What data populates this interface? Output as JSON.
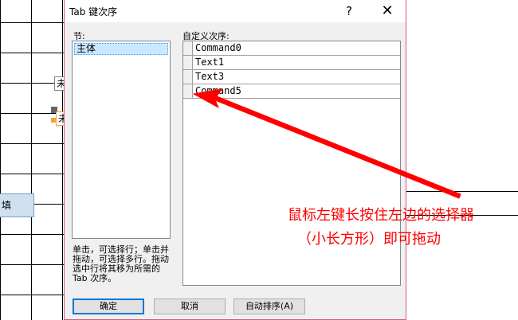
{
  "background": {
    "label_1": "未",
    "label_2": "未",
    "field_text": "填"
  },
  "dialog": {
    "title": "Tab 键次序",
    "help_glyph": "?",
    "close_glyph": "✕",
    "section_label": "节:",
    "section_items": [
      "主体"
    ],
    "order_label": "自定义次序:",
    "order_items": [
      "Command0",
      "Text1",
      "Text3",
      "Command5"
    ],
    "hint": "单击，可选择行；单击并拖动，可选择多行。拖动选中行将其移为所需的 Tab 次序。",
    "buttons": {
      "ok": "确定",
      "cancel": "取消",
      "auto_order": "自动排序(A)"
    }
  },
  "annotation": {
    "line1": "鼠标左键长按住左边的选择器",
    "line2": "（小长方形）即可拖动",
    "color": "#ff0000"
  }
}
